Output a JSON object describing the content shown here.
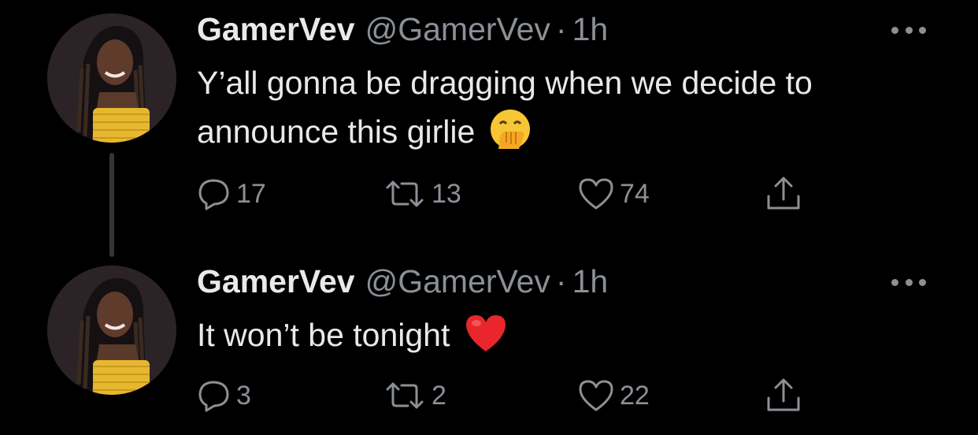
{
  "tweets": [
    {
      "author_name": "GamerVev",
      "author_handle": "@GamerVev",
      "separator": "·",
      "time": "1h",
      "text": "Y’all gonna be dragging when we decide to announce this girlie",
      "emoji": "face-with-hand-over-mouth",
      "replies": "17",
      "retweets": "13",
      "likes": "74"
    },
    {
      "author_name": "GamerVev",
      "author_handle": "@GamerVev",
      "separator": "·",
      "time": "1h",
      "text": "It won’t be tonight",
      "emoji": "red-heart",
      "replies": "3",
      "retweets": "2",
      "likes": "22"
    }
  ],
  "colors": {
    "background": "#000000",
    "primary_text": "#e7e9ea",
    "secondary_text": "#8b9096",
    "thread_line": "#333639"
  }
}
